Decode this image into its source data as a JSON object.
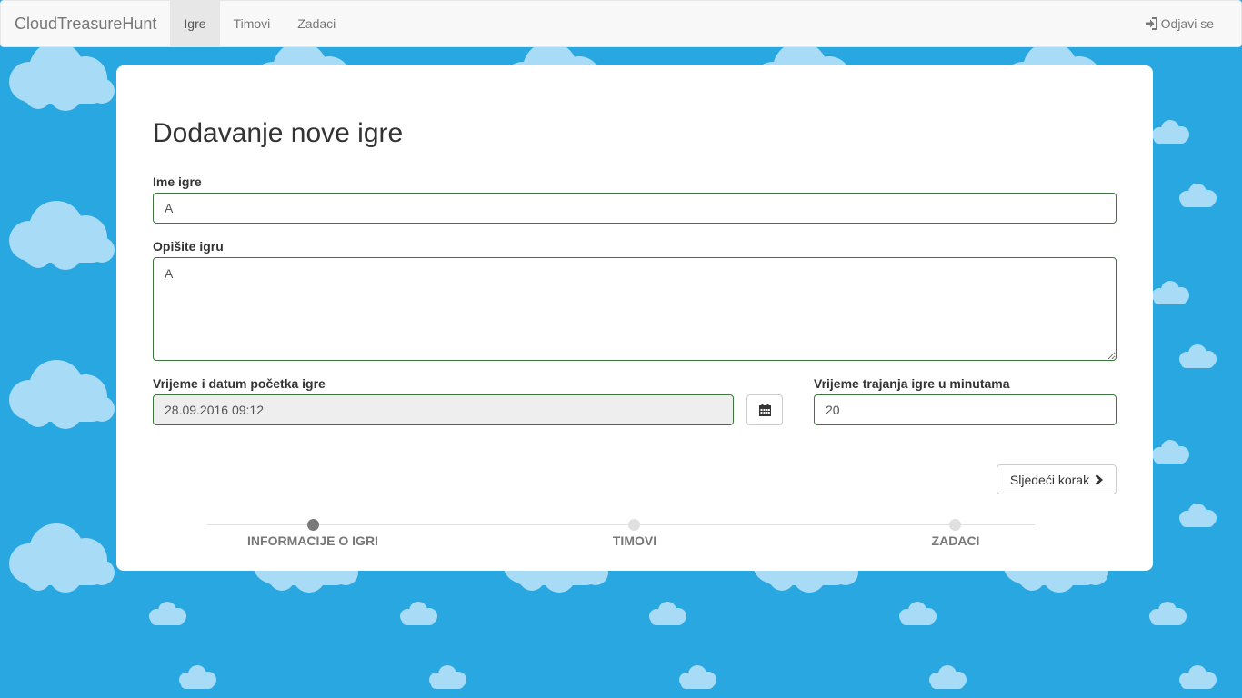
{
  "nav": {
    "brand": "CloudTreasureHunt",
    "items": [
      {
        "label": "Igre"
      },
      {
        "label": "Timovi"
      },
      {
        "label": "Zadaci"
      }
    ],
    "logout_label": "Odjavi se"
  },
  "form": {
    "title": "Dodavanje nove igre",
    "name_label": "Ime igre",
    "name_value": "A",
    "description_label": "Opišite igru",
    "description_value": "A",
    "start_label": "Vrijeme i datum početka igre",
    "start_value": "28.09.2016 09:12",
    "duration_label": "Vrijeme trajanja igre u minutama",
    "duration_value": "20",
    "next_label": "Sljedeći korak"
  },
  "steps": [
    {
      "label": "INFORMACIJE O IGRI",
      "active": true
    },
    {
      "label": "TIMOVI",
      "active": false
    },
    {
      "label": "ZADACI",
      "active": false
    }
  ],
  "colors": {
    "background": "#29a7e1",
    "cloud": "#a8dbf5",
    "valid_border": "#3c763d"
  }
}
